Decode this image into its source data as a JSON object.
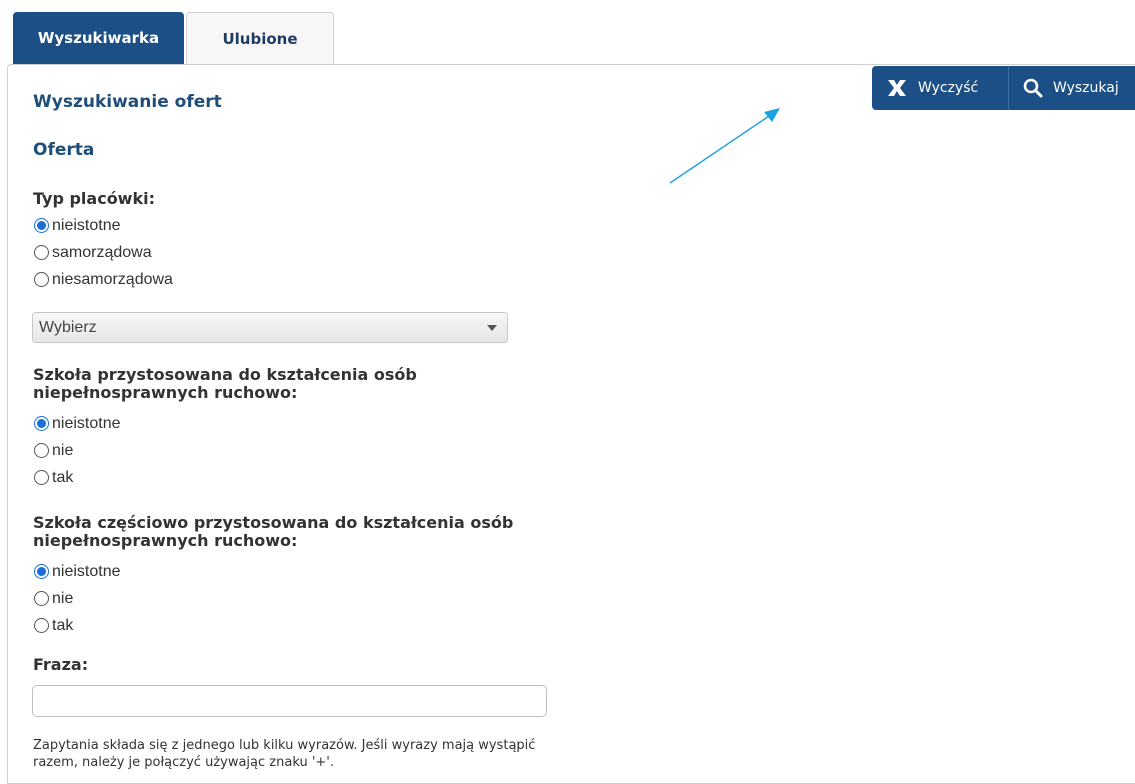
{
  "tabs": [
    {
      "label": "Wyszukiwarka",
      "active": true
    },
    {
      "label": "Ulubione",
      "active": false
    }
  ],
  "toolbar": {
    "clear_label": "Wyczyść",
    "search_label": "Wyszukaj",
    "clear_icon": "close-x-icon",
    "search_icon": "magnifier-icon"
  },
  "page_title": "Wyszukiwanie ofert",
  "section_title": "Oferta",
  "typ_placowki": {
    "label": "Typ placówki:",
    "options": [
      "nieistotne",
      "samorządowa",
      "niesamorządowa"
    ],
    "selected": "nieistotne",
    "select_value": "Wybierz"
  },
  "przystosowana": {
    "label": "Szkoła przystosowana do kształcenia osób niepełnosprawnych ruchowo:",
    "options": [
      "nieistotne",
      "nie",
      "tak"
    ],
    "selected": "nieistotne"
  },
  "czesciowo": {
    "label": "Szkoła częściowo przystosowana do kształcenia osób niepełnosprawnych ruchowo:",
    "options": [
      "nieistotne",
      "nie",
      "tak"
    ],
    "selected": "nieistotne"
  },
  "fraza": {
    "label": "Fraza:",
    "value": "",
    "hint": "Zapytania składa się z jednego lub kilku wyrazów. Jeśli wyrazy mają wystąpić razem, należy je połączyć używając znaku '+'."
  },
  "colors": {
    "primary": "#1b4f86",
    "heading": "#1e4e79",
    "radio_checked": "#1a6ed8",
    "annotation_arrow": "#1aa3e0"
  }
}
